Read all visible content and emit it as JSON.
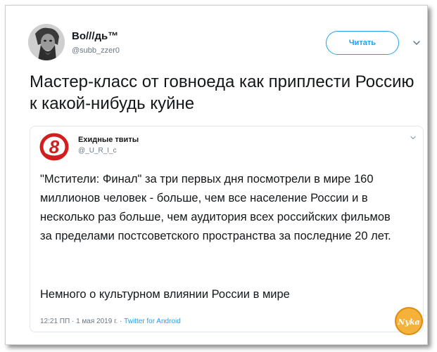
{
  "tweet": {
    "author": {
      "display_name": "Во///дь™",
      "handle": "@subb_zzer0",
      "avatar_icon": "portrait-avatar"
    },
    "follow_label": "Читать",
    "text": "Мастер-класс от говноеда как приплести Россию к какой-нибудь куйне"
  },
  "quoted_tweet": {
    "author": {
      "display_name": "Ехидные твиты",
      "handle": "@_U_R_I_c",
      "logo_icon": "channel-8-logo"
    },
    "body": "\"Мстители: Финал\" за три первых дня посмотрели в мире 160 миллионов человек - больше, чем все население России и в несколько раз больше, чем аудитория всех российских фильмов за пределами постсоветского пространства за последние 20 лет.",
    "footer": "Немного о культурном влиянии России в мире",
    "meta": {
      "time": "12:21 ПП",
      "separator": " · ",
      "date": "1 мая 2019 г.",
      "source": "Twitter for Android"
    }
  },
  "watermark": {
    "text": "Nyka",
    "color": "#f0a020"
  },
  "colors": {
    "accent": "#1da1f2",
    "text": "#14171a",
    "muted": "#657786",
    "border": "#e1e8ed"
  }
}
